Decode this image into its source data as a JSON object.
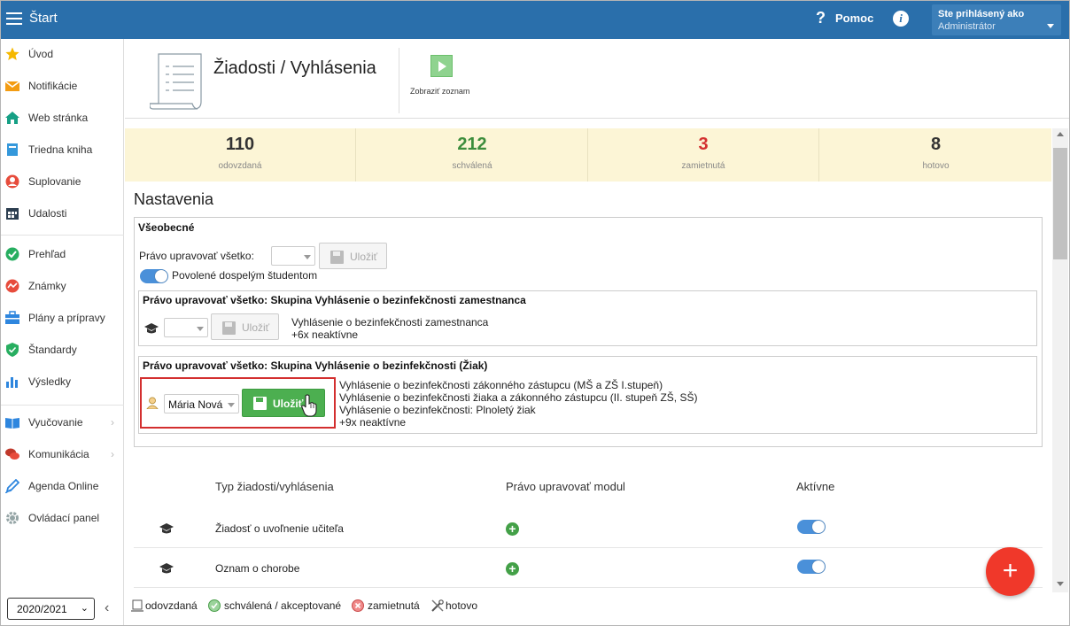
{
  "topbar": {
    "title": "Štart",
    "help": "Pomoc",
    "info": "i",
    "user_caption": "Ste prihlásený ako",
    "user_role": "Administrátor"
  },
  "sidebar": {
    "items": [
      {
        "label": "Úvod",
        "icon": "star-icon",
        "color": "#f5b800"
      },
      {
        "label": "Notifikácie",
        "icon": "envelope-icon",
        "color": "#f39c12"
      },
      {
        "label": "Web stránka",
        "icon": "home-icon",
        "color": "#16a085"
      },
      {
        "label": "Triedna kniha",
        "icon": "book-icon",
        "color": "#3498db"
      },
      {
        "label": "Suplovanie",
        "icon": "user-icon",
        "color": "#e74c3c"
      },
      {
        "label": "Udalosti",
        "icon": "calendar-icon",
        "color": "#2c3e50"
      },
      {
        "label": "Prehľad",
        "icon": "check-circle-icon",
        "color": "#27ae60"
      },
      {
        "label": "Známky",
        "icon": "grade-icon",
        "color": "#e74c3c"
      },
      {
        "label": "Plány a prípravy",
        "icon": "briefcase-icon",
        "color": "#2e86de"
      },
      {
        "label": "Štandardy",
        "icon": "shield-icon",
        "color": "#27ae60"
      },
      {
        "label": "Výsledky",
        "icon": "bar-chart-icon",
        "color": "#2e86de"
      },
      {
        "label": "Vyučovanie",
        "icon": "open-book-icon",
        "color": "#2e86de"
      },
      {
        "label": "Komunikácia",
        "icon": "chat-icon",
        "color": "#c0392b"
      },
      {
        "label": "Agenda Online",
        "icon": "pen-icon",
        "color": "#2e86de"
      },
      {
        "label": "Ovládací panel",
        "icon": "gear-icon",
        "color": "#95a5a6"
      }
    ],
    "year": "2020/2021"
  },
  "header": {
    "title": "Žiadosti / Vyhlásenia",
    "show_list": "Zobraziť zoznam"
  },
  "stats": [
    {
      "value": "110",
      "caption": "odovzdaná",
      "color": "#333333"
    },
    {
      "value": "212",
      "caption": "schválená",
      "color": "#3c8d3c"
    },
    {
      "value": "3",
      "caption": "zamietnutá",
      "color": "#d32f2f"
    },
    {
      "value": "8",
      "caption": "hotovo",
      "color": "#333333"
    }
  ],
  "settings": {
    "title": "Nastavenia",
    "general": "Všeobecné",
    "edit_all_label": "Právo upravovať všetko:",
    "save": "Uložiť",
    "adult_students": "Povolené dospelým študentom",
    "group1": {
      "title": "Právo upravovať všetko: Skupina Vyhlásenie o bezinfekčnosti zamestnanca",
      "lines": [
        "Vyhlásenie o bezinfekčnosti zamestnanca",
        "+6x neaktívne"
      ]
    },
    "group2": {
      "title": "Právo upravovať všetko: Skupina Vyhlásenie o bezinfekčnosti (Žiak)",
      "selected": "Mária Nová",
      "lines": [
        "Vyhlásenie o bezinfekčnosti zákonného zástupcu (MŠ a ZŠ I.stupeň)",
        "Vyhlásenie o bezinfekčnosti žiaka a zákonného zástupcu (II. stupeň ZŠ, SŠ)",
        "Vyhlásenie o bezinfekčnosti: Plnoletý žiak",
        "+9x neaktívne"
      ]
    }
  },
  "table": {
    "headers": [
      "Typ žiadosti/vyhlásenia",
      "Právo upravovať modul",
      "Aktívne"
    ],
    "rows": [
      {
        "name": "Žiadosť o uvoľnenie učiteľa"
      },
      {
        "name": "Oznam o chorobe"
      }
    ]
  },
  "legend": [
    "odovzdaná",
    "schválená / akceptované",
    "zamietnutá",
    "hotovo"
  ]
}
